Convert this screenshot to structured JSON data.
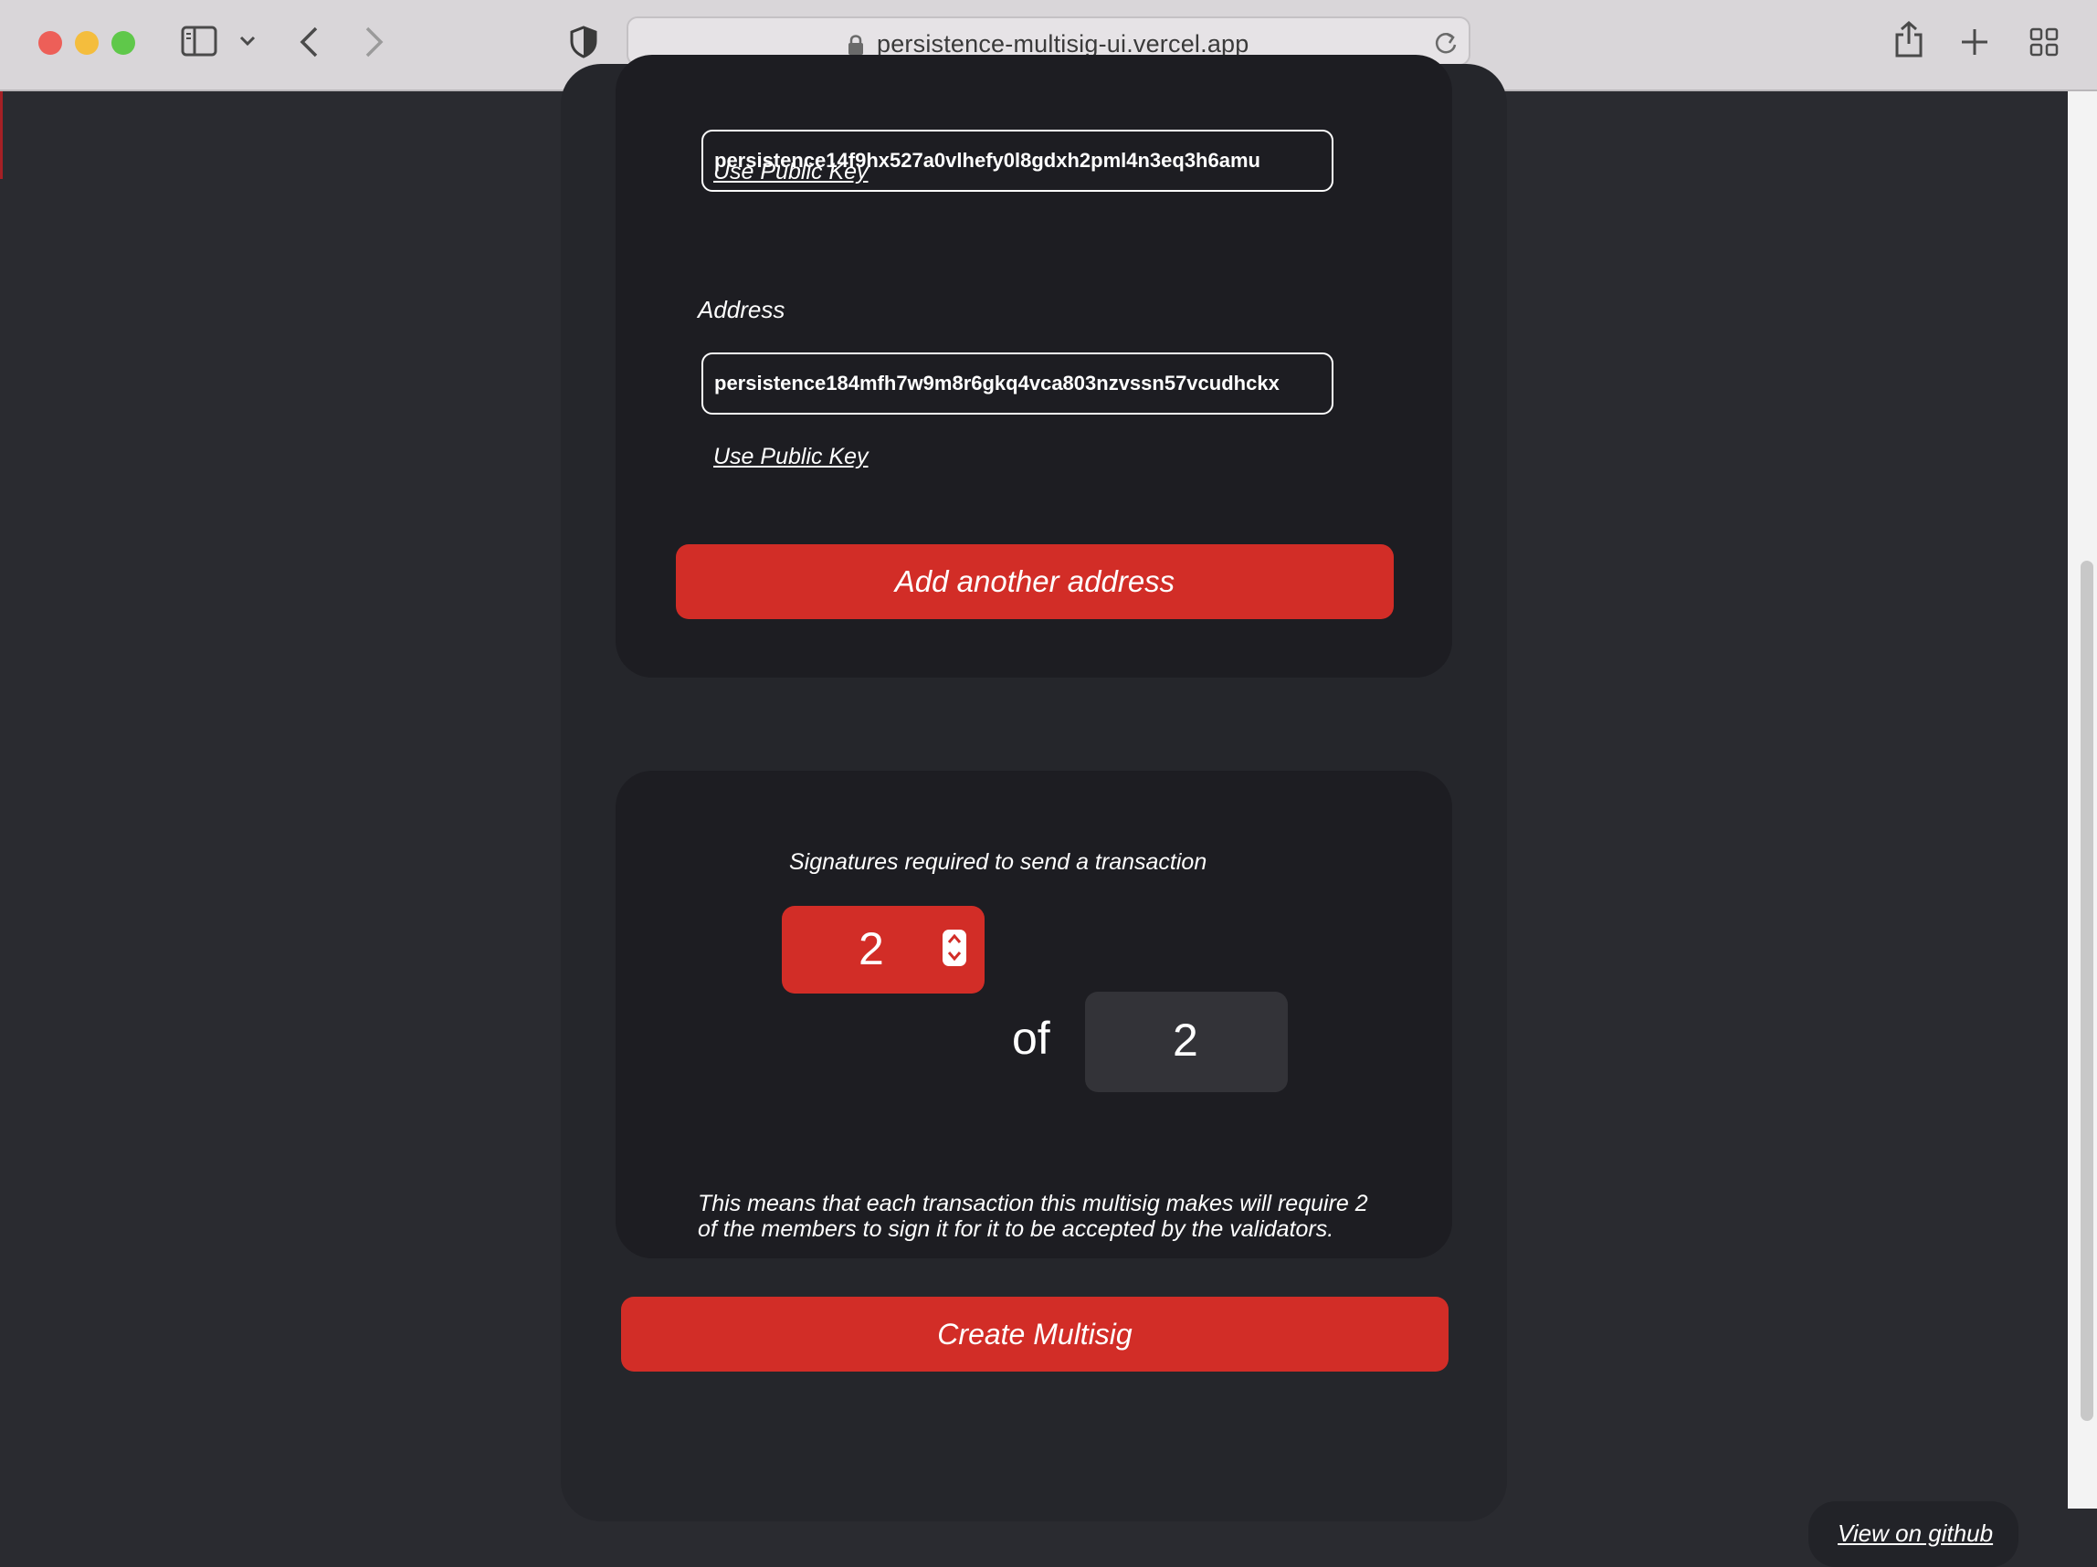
{
  "browser": {
    "url": "persistence-multisig-ui.vercel.app",
    "icons": [
      "sidebar-icon",
      "chevron-down-icon",
      "back-icon",
      "forward-icon",
      "shield-icon",
      "lock-icon",
      "reload-icon",
      "share-icon",
      "new-tab-icon",
      "tab-overview-icon"
    ]
  },
  "members": [
    {
      "label": "",
      "address": "persistence14f9hx527a0vlhefy0l8gdxh2pml4n3eq3h6amu",
      "link": "Use Public Key"
    },
    {
      "label": "Address",
      "address": "persistence184mfh7w9m8r6gkq4vca803nzvssn57vcudhckx",
      "link": "Use Public Key"
    }
  ],
  "add_button": "Add another address",
  "threshold": {
    "title": "Signatures required to send a transaction",
    "required": "2",
    "of": "of",
    "total": "2",
    "description": "This means that each transaction this multisig makes will require 2 of the members to sign it for it to be accepted by the validators."
  },
  "create_button": "Create Multisig",
  "github_link": "View on github",
  "colors": {
    "accent": "#d22d27",
    "page_bg": "#2a2b30",
    "card_bg": "#1d1d22"
  }
}
